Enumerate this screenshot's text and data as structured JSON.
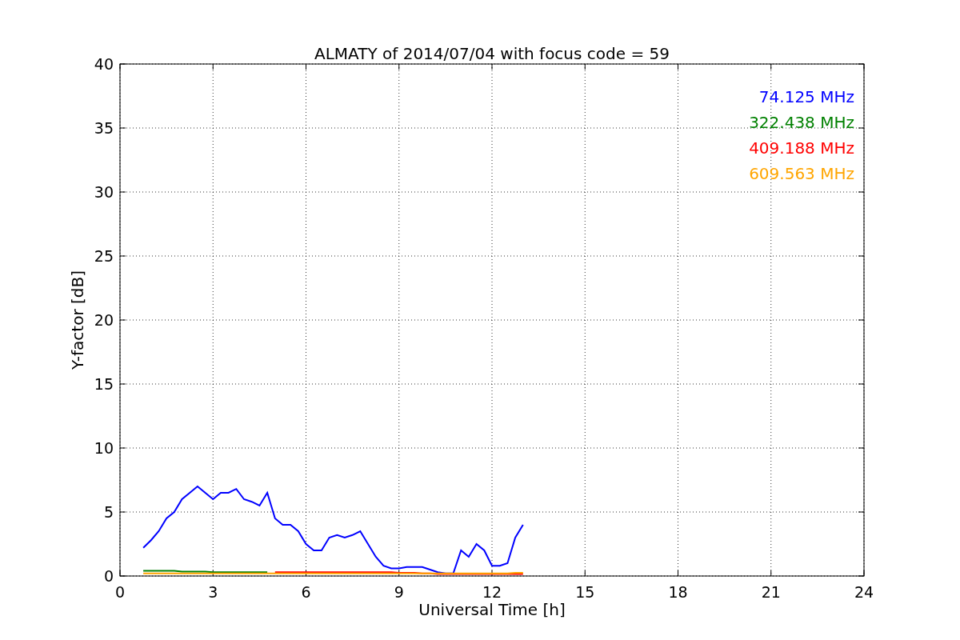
{
  "chart_data": {
    "type": "line",
    "title": "ALMATY of 2014/07/04 with focus code = 59",
    "xlabel": "Universal Time [h]",
    "ylabel": "Y-factor [dB]",
    "x": [
      0.75,
      1.0,
      1.25,
      1.5,
      1.75,
      2.0,
      2.25,
      2.5,
      2.75,
      3.0,
      3.25,
      3.5,
      3.75,
      4.0,
      4.25,
      4.5,
      4.75,
      5.0,
      5.25,
      5.5,
      5.75,
      6.0,
      6.25,
      6.5,
      6.75,
      7.0,
      7.25,
      7.5,
      7.75,
      8.0,
      8.25,
      8.5,
      8.75,
      9.0,
      9.25,
      9.5,
      9.75,
      10.0,
      10.25,
      10.5,
      10.75,
      11.0,
      11.25,
      11.5,
      11.75,
      12.0,
      12.25,
      12.5,
      12.75,
      13.0
    ],
    "series": [
      {
        "name": "74.125 MHz",
        "color": "#0000ff",
        "values": [
          2.2,
          2.8,
          3.5,
          4.5,
          5.0,
          6.0,
          6.5,
          7.0,
          6.5,
          6.0,
          6.5,
          6.5,
          6.8,
          6.0,
          5.8,
          5.5,
          6.5,
          4.5,
          4.0,
          4.0,
          3.5,
          2.5,
          2.0,
          2.0,
          3.0,
          3.2,
          3.0,
          3.2,
          3.5,
          2.5,
          1.5,
          0.8,
          0.6,
          0.6,
          0.7,
          0.7,
          0.7,
          0.5,
          0.3,
          0.2,
          0.2,
          2.0,
          1.5,
          2.5,
          2.0,
          0.8,
          0.8,
          1.0,
          3.0,
          4.0
        ]
      },
      {
        "name": "322.438 MHz",
        "color": "#008000",
        "values": [
          0.4,
          0.4,
          0.4,
          0.4,
          0.4,
          0.35,
          0.35,
          0.35,
          0.35,
          0.3,
          0.3,
          0.3,
          0.3,
          0.3,
          0.3,
          0.3,
          0.3,
          null,
          null,
          null,
          null,
          null,
          null,
          null,
          null,
          null,
          null,
          null,
          null,
          null,
          null,
          null,
          null,
          null,
          null,
          null,
          null,
          null,
          null,
          null,
          null,
          null,
          null,
          null,
          null,
          null,
          null,
          null,
          null,
          null
        ]
      },
      {
        "name": "409.188 MHz",
        "color": "#ff0000",
        "values": [
          null,
          null,
          null,
          null,
          null,
          null,
          null,
          null,
          null,
          null,
          null,
          null,
          null,
          null,
          null,
          null,
          null,
          0.3,
          0.3,
          0.3,
          0.3,
          0.3,
          0.3,
          0.3,
          0.3,
          0.3,
          0.3,
          0.3,
          0.3,
          0.3,
          0.3,
          0.3,
          0.3,
          0.25,
          0.25,
          0.25,
          0.2,
          0.2,
          0.15,
          0.15,
          0.15,
          0.15,
          0.15,
          0.15,
          0.15,
          0.15,
          0.15,
          0.15,
          0.15,
          0.15
        ]
      },
      {
        "name": "609.563 MHz",
        "color": "#ffa500",
        "values": [
          0.2,
          0.2,
          0.2,
          0.2,
          0.2,
          0.2,
          0.2,
          0.2,
          0.2,
          0.2,
          0.2,
          0.2,
          0.2,
          0.2,
          0.2,
          0.2,
          0.2,
          0.2,
          0.2,
          0.2,
          0.2,
          0.2,
          0.2,
          0.2,
          0.2,
          0.2,
          0.2,
          0.2,
          0.2,
          0.2,
          0.2,
          0.2,
          0.2,
          0.2,
          0.2,
          0.2,
          0.2,
          0.2,
          0.2,
          0.2,
          0.2,
          0.2,
          0.2,
          0.2,
          0.2,
          0.2,
          0.2,
          0.2,
          0.25,
          0.25
        ]
      }
    ],
    "xlim": [
      0,
      24
    ],
    "ylim": [
      0,
      40
    ],
    "xticks": [
      0,
      3,
      6,
      9,
      12,
      15,
      18,
      21,
      24
    ],
    "yticks": [
      0,
      5,
      10,
      15,
      20,
      25,
      30,
      35,
      40
    ],
    "grid": true
  }
}
